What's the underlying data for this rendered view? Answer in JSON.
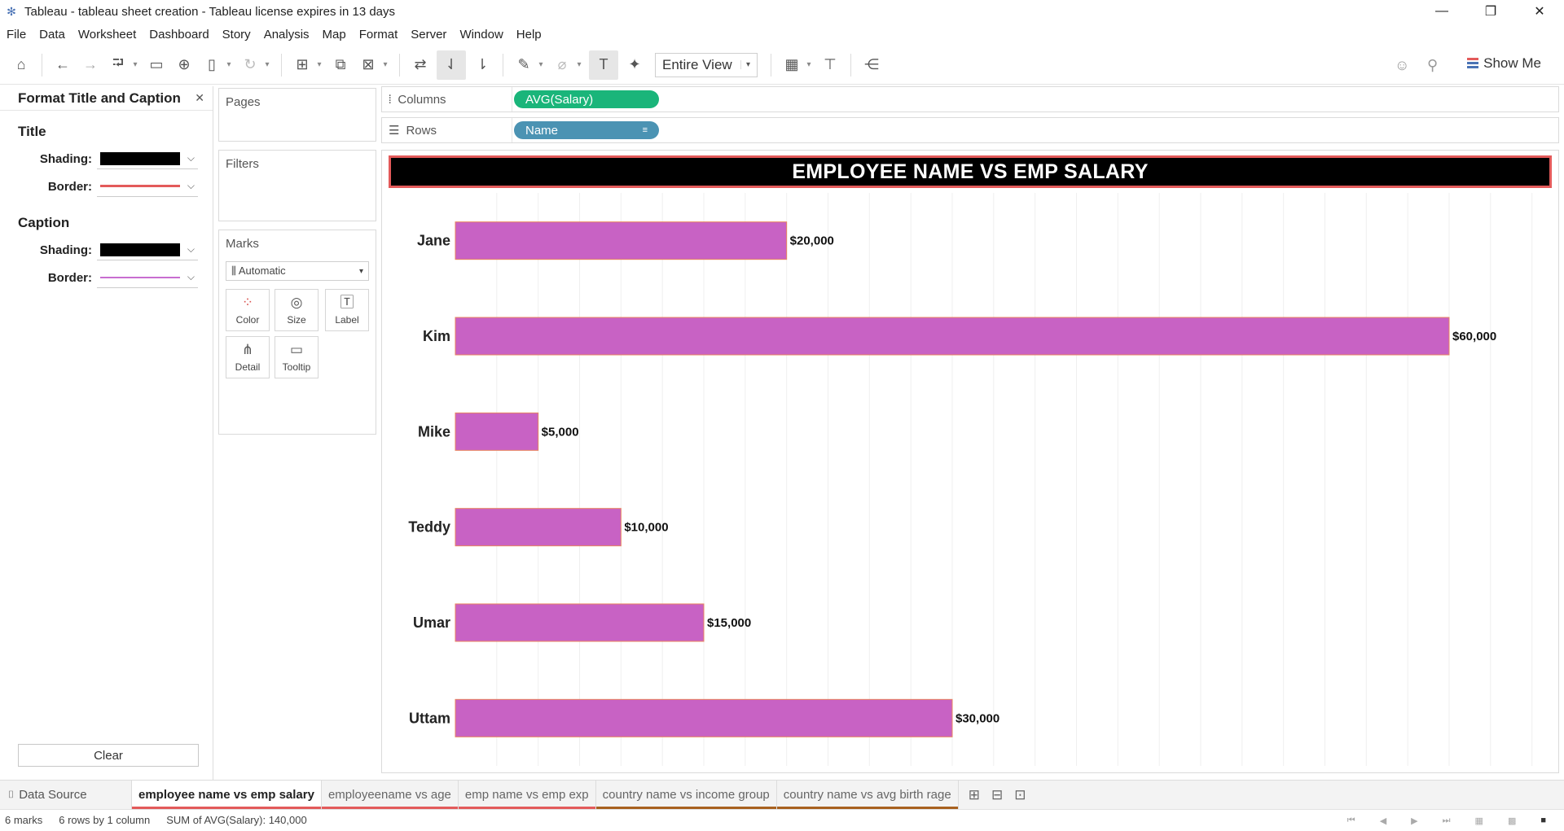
{
  "window": {
    "title": "Tableau - tableau sheet creation - Tableau license expires in 13 days",
    "controls": [
      "—",
      "❐",
      "✕"
    ]
  },
  "menu": [
    "File",
    "Data",
    "Worksheet",
    "Dashboard",
    "Story",
    "Analysis",
    "Map",
    "Format",
    "Server",
    "Window",
    "Help"
  ],
  "toolbar": {
    "fit_value": "Entire View",
    "show_me_label": "Show Me"
  },
  "format_pane": {
    "title": "Format Title and Caption",
    "title_section": "Title",
    "caption_section": "Caption",
    "shading_label": "Shading:",
    "border_label": "Border:",
    "clear_label": "Clear",
    "colors": {
      "title_shading": "#000000",
      "title_border": "#e35a5a",
      "caption_shading": "#000000",
      "caption_border": "#c86dd0"
    }
  },
  "cards": {
    "pages": "Pages",
    "filters": "Filters",
    "marks": "Marks",
    "mark_type": "Automatic",
    "mark_buttons": [
      "Color",
      "Size",
      "Label",
      "Detail",
      "Tooltip"
    ]
  },
  "shelves": {
    "columns_label": "Columns",
    "rows_label": "Rows",
    "columns_pill": "AVG(Salary)",
    "rows_pill": "Name"
  },
  "chart_data": {
    "type": "bar",
    "orientation": "horizontal",
    "title": "EMPLOYEE NAME VS EMP SALARY",
    "categories": [
      "Jane",
      "Kim",
      "Mike",
      "Teddy",
      "Umar",
      "Uttam"
    ],
    "values": [
      20000,
      60000,
      5000,
      10000,
      15000,
      30000
    ],
    "data_labels": [
      "$20,000",
      "$60,000",
      "$5,000",
      "$10,000",
      "$15,000",
      "$30,000"
    ],
    "xlim": [
      0,
      66000
    ],
    "grid": true,
    "bar_color": "#c862c4",
    "bar_border": "#e8845f"
  },
  "sheet_tabs": {
    "data_source": "Data Source",
    "tabs": [
      {
        "label": "employee name vs emp salary",
        "active": true,
        "underline": "#e35a5a"
      },
      {
        "label": "employeename vs age",
        "active": false,
        "underline": "#e35a5a"
      },
      {
        "label": "emp name vs emp exp",
        "active": false,
        "underline": "#e35a5a"
      },
      {
        "label": "country name vs income group",
        "active": false,
        "underline": "#a8611f"
      },
      {
        "label": "country name vs avg birth rage",
        "active": false,
        "underline": "#a8611f"
      }
    ]
  },
  "status": {
    "marks": "6 marks",
    "dims": "6 rows by 1 column",
    "sum": "SUM of AVG(Salary): 140,000"
  }
}
